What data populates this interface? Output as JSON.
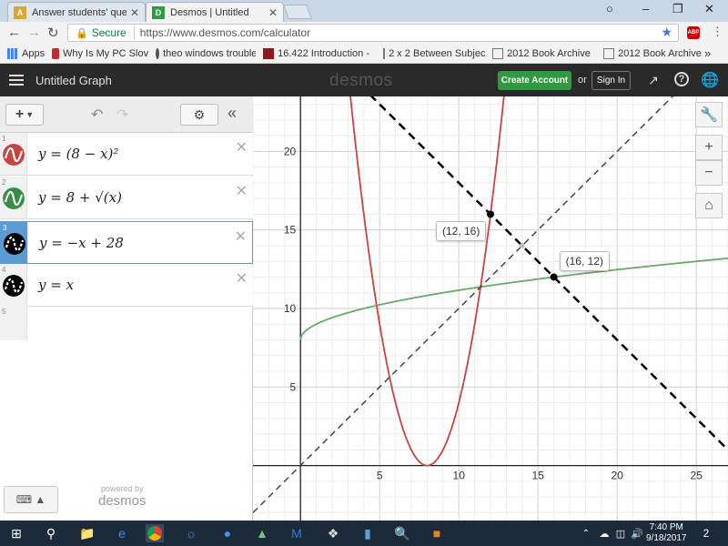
{
  "browser": {
    "tabs": [
      {
        "title": "Answer students' questio",
        "favicon_color": "#d9a63a"
      },
      {
        "title": "Desmos | Untitled",
        "favicon_color": "#2f9a3f"
      }
    ],
    "secure_label": "Secure",
    "url": "https://www.desmos.com/calculator",
    "abp_label": "ABP",
    "bookmarks": [
      {
        "label": "Apps",
        "icon": "apps-grid-icon"
      },
      {
        "label": "Why Is My PC Slov",
        "icon": "power-icon"
      },
      {
        "label": "theo windows trouble",
        "icon": "squiggle-icon"
      },
      {
        "label": "16.422 Introduction -",
        "icon": "mit-icon"
      },
      {
        "label": "2 x 2 Between Subjec",
        "icon": "page-icon"
      },
      {
        "label": "2012 Book Archive",
        "icon": "page-icon"
      },
      {
        "label": "2012 Book Archive",
        "icon": "page-icon"
      }
    ],
    "more_bookmarks": "»"
  },
  "header": {
    "title": "Untitled Graph",
    "logo": "desmos",
    "create_account": "Create Account",
    "or": "or",
    "sign_in": "Sign In"
  },
  "expressions": {
    "items": [
      {
        "num": "1",
        "math": "y = (8 − x)²",
        "color": "#c74440"
      },
      {
        "num": "2",
        "math": "y = 8 + √(x)",
        "color": "#388c46"
      },
      {
        "num": "3",
        "math": "y = −x + 28",
        "color": "#000000"
      },
      {
        "num": "4",
        "math": "y = x",
        "color": "#000000"
      },
      {
        "num": "5",
        "math": "",
        "color": ""
      }
    ],
    "powered_by": "powered by",
    "powered_logo": "desmos"
  },
  "graph": {
    "point_labels": [
      {
        "text": "(12, 16)"
      },
      {
        "text": "(16, 12)"
      }
    ]
  },
  "chart_data": {
    "type": "line",
    "xlim": [
      -3,
      27
    ],
    "ylim": [
      -3.5,
      23.5
    ],
    "x_ticks": [
      5,
      10,
      15,
      20,
      25
    ],
    "y_ticks": [
      5,
      10,
      15,
      20
    ],
    "grid": true,
    "series": [
      {
        "name": "y = (8 − x)²",
        "color": "#c74440",
        "style": "solid",
        "fn": "parabola"
      },
      {
        "name": "y = 8 + √(x)",
        "color": "#6aa86a",
        "style": "solid",
        "fn": "sqrt"
      },
      {
        "name": "y = −x + 28",
        "color": "#000000",
        "style": "dashed",
        "fn": "line_neg"
      },
      {
        "name": "y = x",
        "color": "#444444",
        "style": "dashed",
        "fn": "identity"
      }
    ],
    "points": [
      {
        "x": 12,
        "y": 16,
        "label": "(12, 16)"
      },
      {
        "x": 16,
        "y": 12,
        "label": "(16, 12)"
      }
    ]
  },
  "taskbar": {
    "time": "7:40 PM",
    "date": "9/18/2017",
    "notifications": "2"
  }
}
